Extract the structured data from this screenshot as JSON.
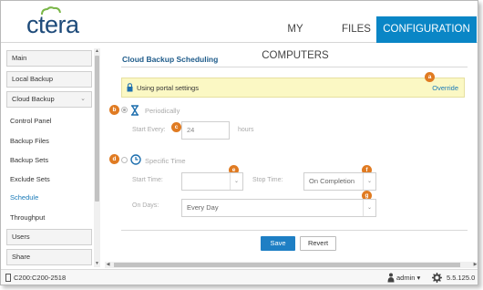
{
  "header": {
    "logo": "ctera",
    "tabs": [
      "MY COMPUTERS",
      "FILES",
      "CONFIGURATION"
    ],
    "active_tab": "CONFIGURATION",
    "accent": "#0a86c6"
  },
  "sidebar": {
    "categories": [
      "Main",
      "Local Backup",
      "Cloud Backup",
      "Users",
      "Share"
    ],
    "items": [
      "Control Panel",
      "Backup Files",
      "Backup Sets",
      "Exclude Sets",
      "Schedule",
      "Throughput"
    ],
    "active_item": "Schedule"
  },
  "main": {
    "title": "Cloud Backup Scheduling",
    "info_text": "Using portal settings",
    "override_label": "Override",
    "periodically": {
      "label": "Periodically",
      "start_every_label": "Start Every:",
      "start_every_value": "24",
      "unit": "hours"
    },
    "specific_time": {
      "label": "Specific Time",
      "start_time_label": "Start Time:",
      "start_time_value": "",
      "stop_time_label": "Stop Time:",
      "stop_time_value": "On Completion",
      "on_days_label": "On Days:",
      "on_days_value": "Every Day"
    },
    "badges": [
      "a",
      "b",
      "c",
      "d",
      "e",
      "f",
      "g"
    ],
    "save_label": "Save",
    "revert_label": "Revert"
  },
  "statusbar": {
    "device": "C200:C200-2518",
    "user": "admin",
    "version": "5.5.125.0"
  }
}
